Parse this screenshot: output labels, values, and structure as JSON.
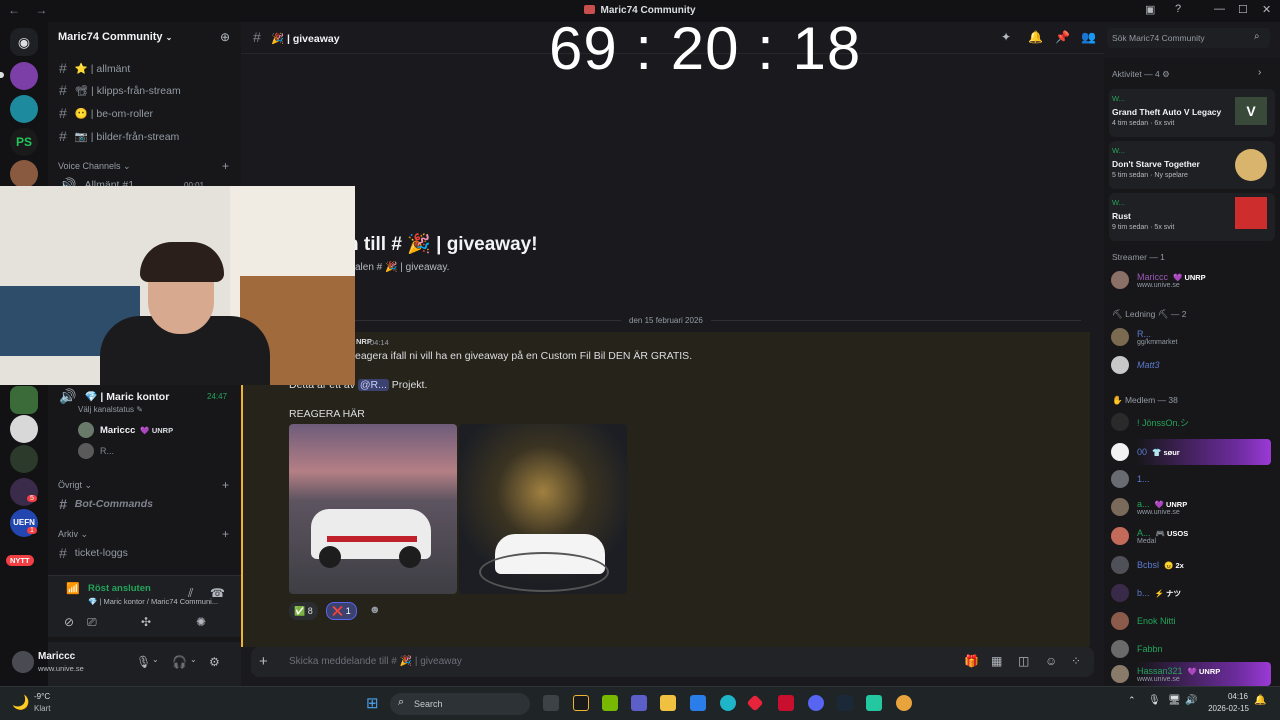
{
  "window": {
    "title": "Maric74 Community",
    "nav": "← →"
  },
  "timer": "69 : 20 : 18",
  "server": {
    "name": "Maric74 Community"
  },
  "channels": [
    {
      "label": "⭐ | allmänt"
    },
    {
      "label": "📽 | klipps-från-stream"
    },
    {
      "label": "😶 | be-om-roller"
    },
    {
      "label": "📷 | bilder-från-stream"
    }
  ],
  "categories": {
    "voice": "Voice Channels",
    "ovrigt": "Övrigt",
    "arkiv": "Arkiv"
  },
  "voice_hidden": {
    "label": "Allmänt #1",
    "time": "00:01"
  },
  "voice_channel": {
    "name": "💎 | Maric kontor",
    "time": "24:47",
    "status": "Välj kanalstatus",
    "users": [
      {
        "name": "Mariccc",
        "badge": "UNRP"
      },
      {
        "name": "R..."
      }
    ]
  },
  "other_channels": [
    {
      "label": "Bot-Commands"
    },
    {
      "label": "ticket-loggs"
    }
  ],
  "voice_status": {
    "connected": "Röst ansluten",
    "where": "💎 | Maric kontor / Maric74 Communi..."
  },
  "user": {
    "name": "Mariccc",
    "status": "www.unive.se"
  },
  "header": {
    "channel": "🎉 | giveaway"
  },
  "welcome": {
    "title": "n till # 🎉 | giveaway!",
    "sub": "alen # 🎉 | giveaway."
  },
  "date_divider": "den 15 februari 2026",
  "message": {
    "author_tag": "NRP",
    "time": "04:14",
    "line1": "eagera ifall ni vill ha en giveaway på en Custom Fil Bil DEN ÄR GRATIS.",
    "line2_prefix": "Detta är ett av",
    "mention": "@R...",
    "line2_suffix": "Projekt.",
    "line3": "REAGERA HÄR",
    "reactions": [
      {
        "emoji": "✅",
        "count": "8"
      },
      {
        "emoji": "❌",
        "count": "1"
      }
    ]
  },
  "composer": {
    "placeholder": "Skicka meddelande till # 🎉 | giveaway"
  },
  "search": {
    "placeholder": "Sök Maric74 Community"
  },
  "activity": {
    "header": "Aktivitet — 4",
    "items": [
      {
        "user": "W...",
        "game": "Grand Theft Auto V Legacy",
        "time": "4 tim sedan",
        "extra": "6x svit"
      },
      {
        "user": "W...",
        "game": "Don't Starve Together",
        "time": "5 tim sedan",
        "extra": "Ny spelare"
      },
      {
        "user": "W...",
        "game": "Rust",
        "time": "9 tim sedan",
        "extra": "5x svit"
      }
    ]
  },
  "members": {
    "streamer_header": "Streamer — 1",
    "streamer": {
      "name": "Mariccc",
      "badge": "UNRP",
      "status": "www.unive.se"
    },
    "ledning_header": "⛏ Ledning ⛏ — 2",
    "ledning": [
      {
        "name": "R...",
        "status": "gg/kmmarket"
      },
      {
        "name": "Matt3",
        "status": ""
      }
    ],
    "medlem_header": "Medlem — 38",
    "medlem": [
      {
        "name": "! JönssOn.シ",
        "badge": "",
        "status": ""
      },
      {
        "name": "00",
        "badge": "søur",
        "status": ""
      },
      {
        "name": "1...",
        "badge": "",
        "status": ""
      },
      {
        "name": "a...",
        "badge": "UNRP",
        "status": "www.unive.se"
      },
      {
        "name": "A...",
        "badge": "USOS",
        "status": "Medal"
      },
      {
        "name": "Bcbsl",
        "badge": "2x",
        "status": ""
      },
      {
        "name": "b...",
        "badge": "ナツ",
        "status": ""
      },
      {
        "name": "Enok Nitti",
        "badge": "",
        "status": ""
      },
      {
        "name": "Fabbn",
        "badge": "",
        "status": ""
      },
      {
        "name": "Hassan321",
        "badge": "UNRP",
        "status": "www.unive.se"
      }
    ]
  },
  "taskbar": {
    "weather_temp": "-9°C",
    "weather_desc": "Klart",
    "search": "Search",
    "time": "04:16",
    "date": "2026-02-15"
  },
  "server_badges": {
    "new": "NYTT",
    "count1": "1",
    "count5": "5"
  },
  "colors": {
    "accent": "#5865f2",
    "mention_bg": "#3c4270",
    "highlight": "#f0b232",
    "online": "#23a55a"
  }
}
